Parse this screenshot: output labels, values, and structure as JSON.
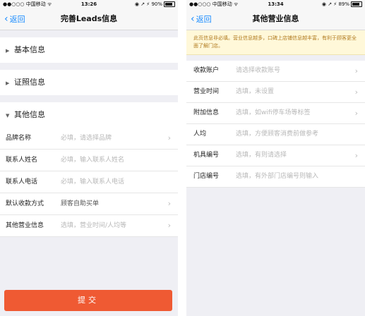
{
  "left": {
    "status": {
      "carrier": "●●○○○ 中国移动 ᯤ",
      "time": "13:26",
      "battery": "◉ ↗ ⚡ 90%"
    },
    "nav": {
      "back_label": "返回",
      "title": "完善Leads信息"
    },
    "sections": [
      {
        "label": "基本信息",
        "expanded": false
      },
      {
        "label": "证照信息",
        "expanded": false
      },
      {
        "label": "其他信息",
        "expanded": true
      }
    ],
    "rows": [
      {
        "label": "品牌名称",
        "value": "必填，请选择品牌",
        "filled": false,
        "chevron": true
      },
      {
        "label": "联系人姓名",
        "value": "必填，输入联系人姓名",
        "filled": false,
        "chevron": false
      },
      {
        "label": "联系人电话",
        "value": "必填，输入联系人电话",
        "filled": false,
        "chevron": false
      },
      {
        "label": "默认收款方式",
        "value": "顾客自助买单",
        "filled": true,
        "chevron": true
      },
      {
        "label": "其他营业信息",
        "value": "选填，营业时间/人均等",
        "filled": false,
        "chevron": true
      }
    ],
    "submit_label": "提交",
    "submit_color": "#ef5a33"
  },
  "right": {
    "status": {
      "carrier": "●●○○○ 中国移动 ᯤ",
      "time": "13:34",
      "battery": "◉ ↗ ⚡ 89%"
    },
    "nav": {
      "back_label": "返回",
      "title": "其他营业信息"
    },
    "notice": "此页信息非必填。营业信息越多，口碑上店铺信息越丰富，有利于顾客更全面了解门店。",
    "rows": [
      {
        "label": "收款账户",
        "value": "请选择收款账号",
        "chevron": true
      },
      {
        "label": "营业时间",
        "value": "选填，未设置",
        "chevron": true
      },
      {
        "label": "附加信息",
        "value": "选填，如wifi停车场等标签",
        "chevron": true
      },
      {
        "label": "人均",
        "value": "选填，方便顾客消费前做参考",
        "chevron": false
      },
      {
        "label": "机具编号",
        "value": "选填，有则请选择",
        "chevron": true
      },
      {
        "label": "门店编号",
        "value": "选填，有外部门店编号则输入",
        "chevron": false
      }
    ]
  },
  "colors": {
    "accent": "#1a8cff",
    "notice_bg": "#fff8d9",
    "notice_text": "#b07a1e"
  }
}
